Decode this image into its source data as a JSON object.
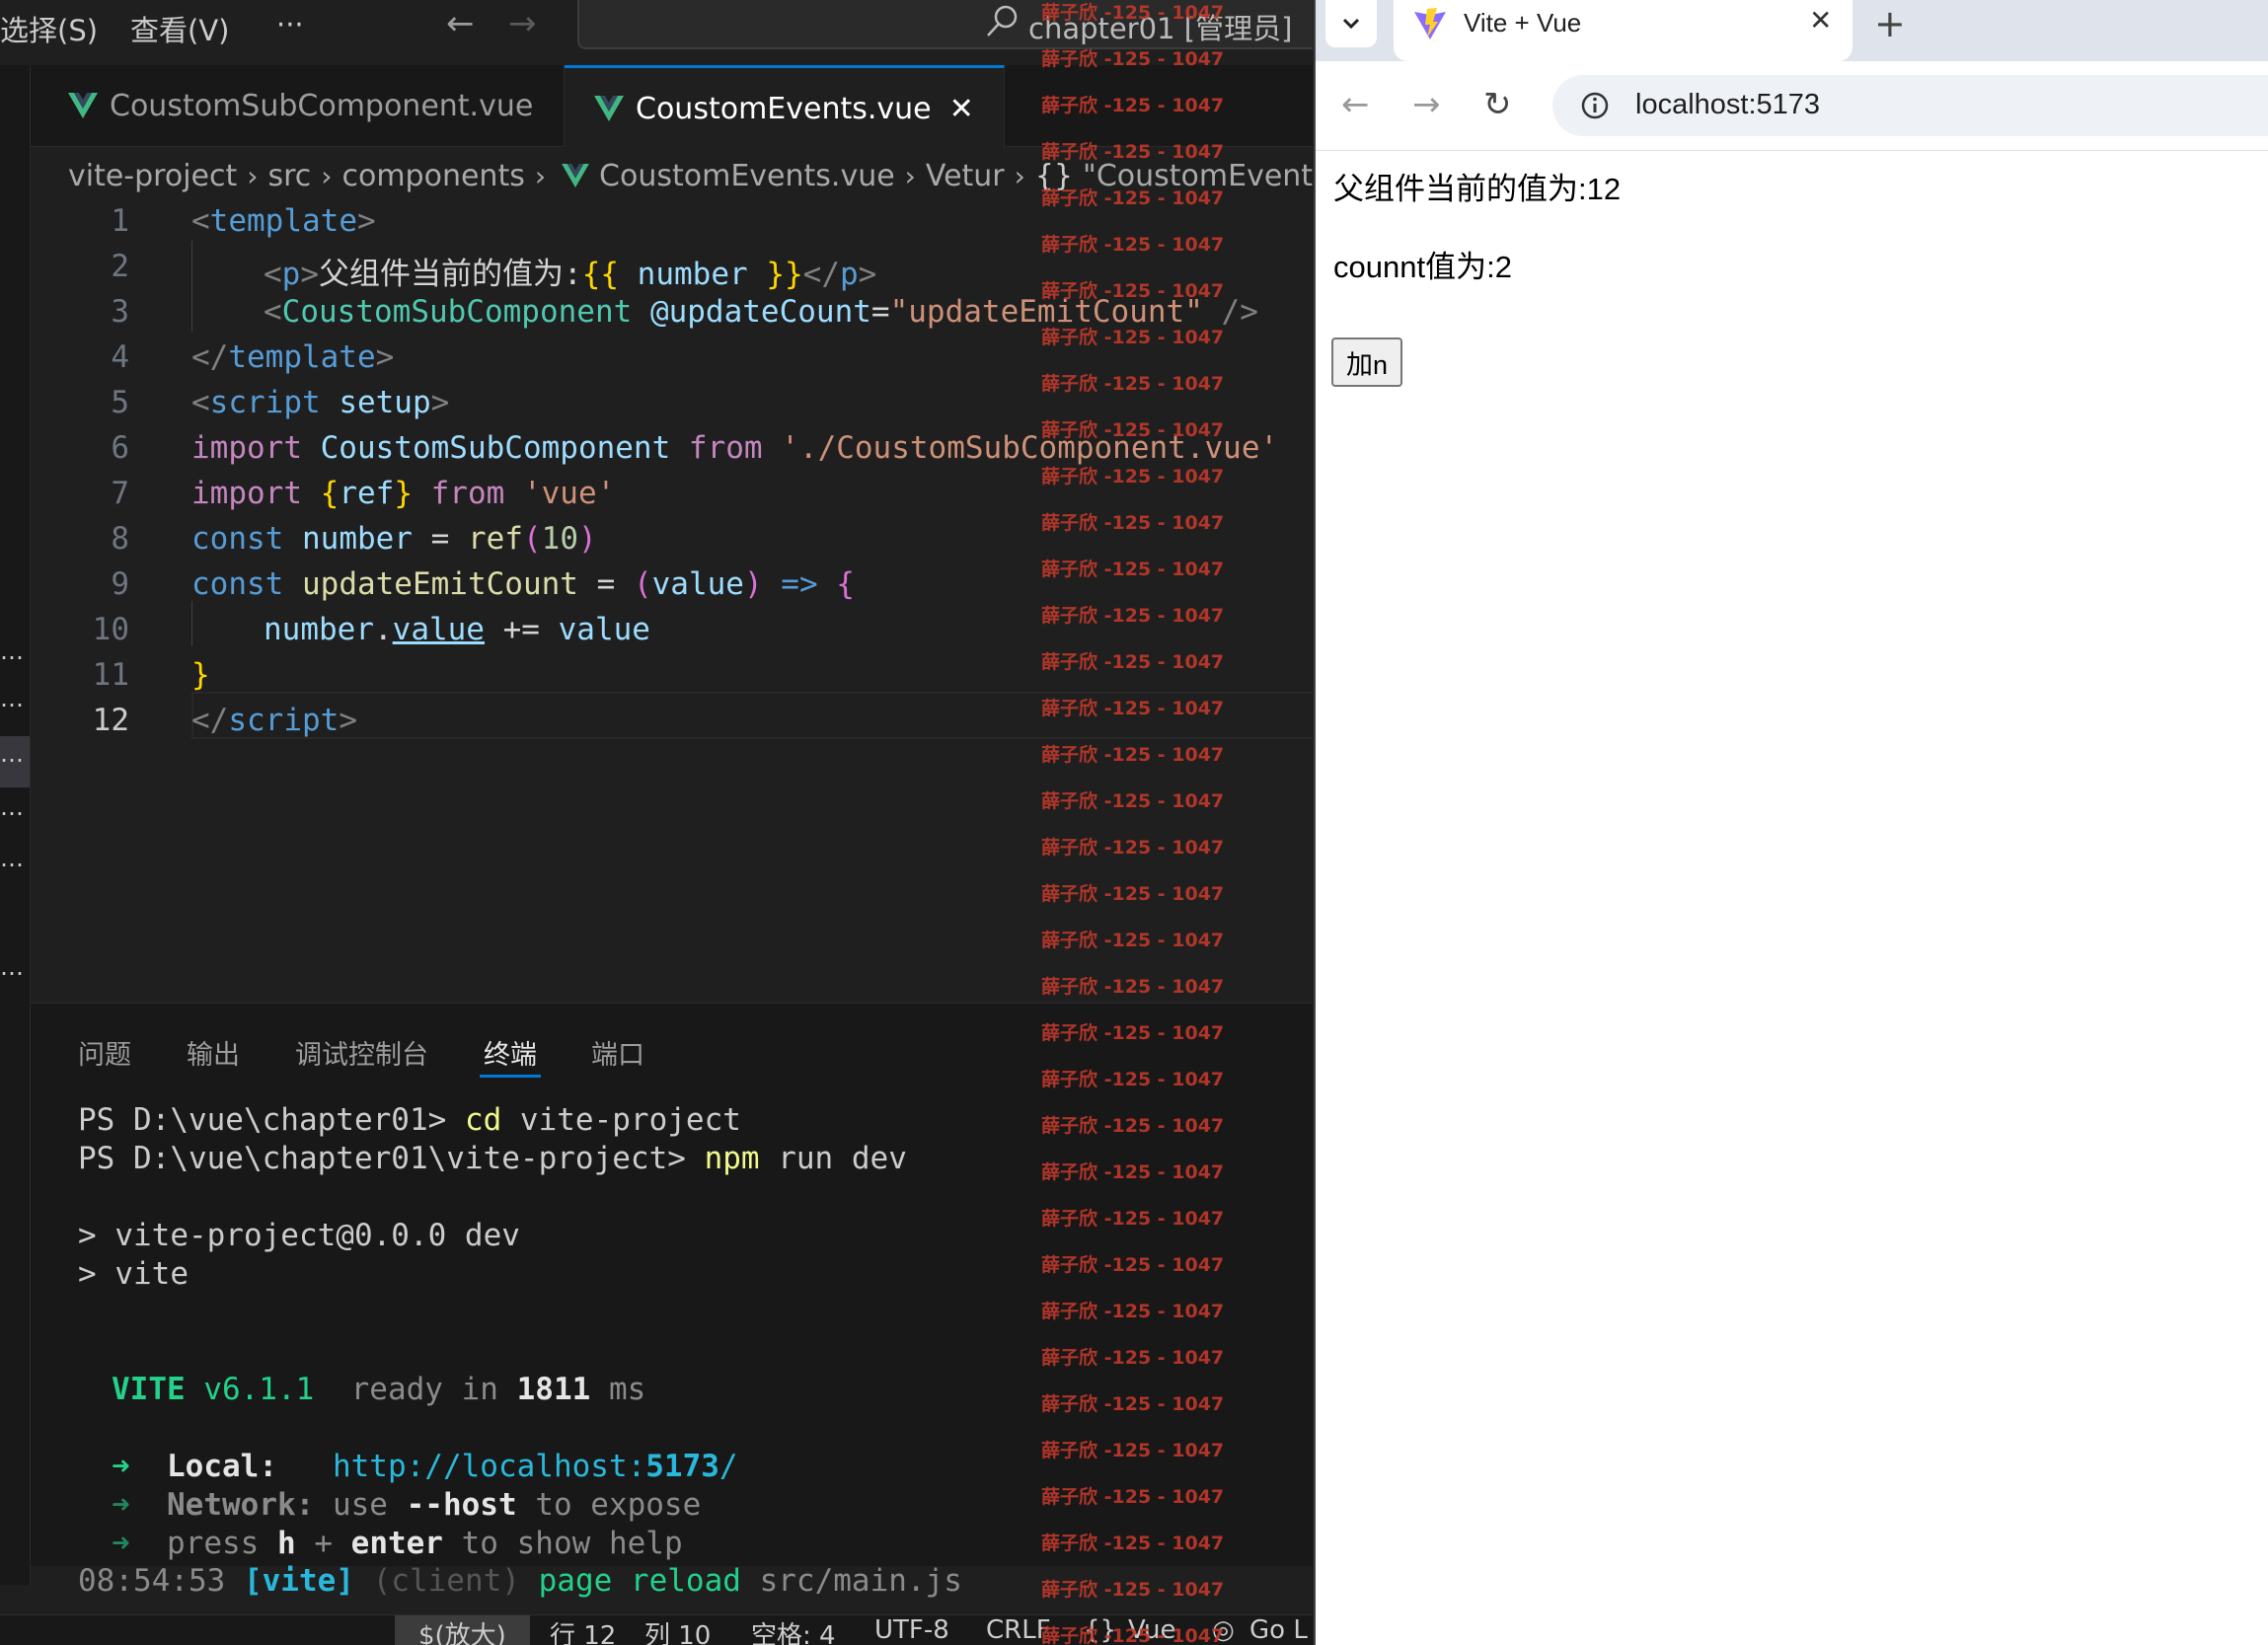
{
  "vscode": {
    "menu": [
      {
        "label": "选择(S)"
      },
      {
        "label": "查看(V)"
      },
      {
        "label": "···"
      }
    ],
    "command_center": "chapter01 [管理员]",
    "tabs": [
      {
        "label": "CoustomSubComponent.vue"
      },
      {
        "label": "CoustomEvents.vue",
        "close": "✕"
      }
    ],
    "breadcrumb": [
      "vite-project",
      "src",
      "components",
      "CoustomEvents.vue",
      "Vetur",
      "\"CoustomEvents.vu"
    ],
    "breadcrumb_braces": "{}",
    "line_numbers": [
      "1",
      "2",
      "3",
      "4",
      "5",
      "6",
      "7",
      "8",
      "9",
      "10",
      "11",
      "12"
    ],
    "active_line": "12",
    "code": {
      "l1": [
        "<",
        "template",
        ">"
      ],
      "l2": [
        "<",
        "p",
        ">",
        "父组件当前的值为:",
        "{{",
        " number ",
        "}}",
        "</",
        "p",
        ">"
      ],
      "l3": [
        "<",
        "CoustomSubComponent",
        " @updateCount",
        "=",
        "\"updateEmitCount\"",
        " />"
      ],
      "l4": [
        "</",
        "template",
        ">"
      ],
      "l5": [
        "<",
        "script",
        " setup",
        ">"
      ],
      "l6": [
        "import",
        " CoustomSubComponent ",
        "from",
        " './CoustomSubComponent.vue'"
      ],
      "l7": [
        "import",
        " {",
        "ref",
        "}",
        " from",
        " 'vue'"
      ],
      "l8": [
        "const",
        " number",
        " = ",
        "ref",
        "(",
        "10",
        ")"
      ],
      "l9": [
        "const",
        " updateEmitCount",
        " = ",
        "(",
        "value",
        ")",
        " =>",
        " {"
      ],
      "l10": [
        "number",
        ".",
        "value",
        " += ",
        "value"
      ],
      "l11": [
        "}"
      ],
      "l12": [
        "</",
        "script",
        ">"
      ]
    },
    "panel_tabs": [
      "问题",
      "输出",
      "调试控制台",
      "终端",
      "端口"
    ],
    "active_panel_tab": "终端",
    "terminal": {
      "l1_prompt": "PS D:\\vue\\chapter01> ",
      "l1_cmd": "cd",
      "l1_arg": " vite-project",
      "l2_prompt": "PS D:\\vue\\chapter01\\vite-project> ",
      "l2_cmd": "npm",
      "l2_arg": " run dev",
      "l3": "> vite-project@0.0.0 dev",
      "l4": "> vite",
      "vite_name": "VITE",
      "vite_version": " v6.1.1",
      "ready_text": "  ready in ",
      "ready_ms": "1811",
      "ready_unit": " ms",
      "local_arrow": "➜",
      "local_label": "Local:",
      "local_url_a": "http://localhost:",
      "local_url_port": "5173",
      "local_url_b": "/",
      "network_arrow": "➜",
      "network_label": "Network:",
      "network_a": " use ",
      "network_flag": "--host",
      "network_b": " to expose",
      "help_arrow": "➜",
      "help_a": "press ",
      "help_h": "h",
      "help_plus": " + ",
      "help_enter": "enter",
      "help_b": " to show help",
      "log_time": "08:54:53 ",
      "log_tag": "[vite]",
      "log_client": " (client)",
      "log_msg": " page reload",
      "log_file": " src/main.js"
    },
    "statusbar": {
      "zoom": "$(放大)",
      "line": "行 12",
      "col": "列 10",
      "spaces": "空格: 4",
      "encoding": "UTF-8",
      "eol": "CRLF",
      "braces": "{}",
      "lang": "Vue",
      "golive": "Go L"
    },
    "watermark": "薛子欣 -125 - 1047"
  },
  "browser": {
    "tab_title": "Vite + Vue",
    "tab_close": "✕",
    "new_tab": "+",
    "url": "localhost:5173",
    "page": {
      "parent_text": "父组件当前的值为:12",
      "count_text": "counnt值为:2",
      "button_label": "加n"
    }
  },
  "colors": {
    "vscode_bg": "#1f1f1f",
    "accent": "#0078d4",
    "watermark": "#c0392b",
    "vue_green": "#41b883"
  }
}
